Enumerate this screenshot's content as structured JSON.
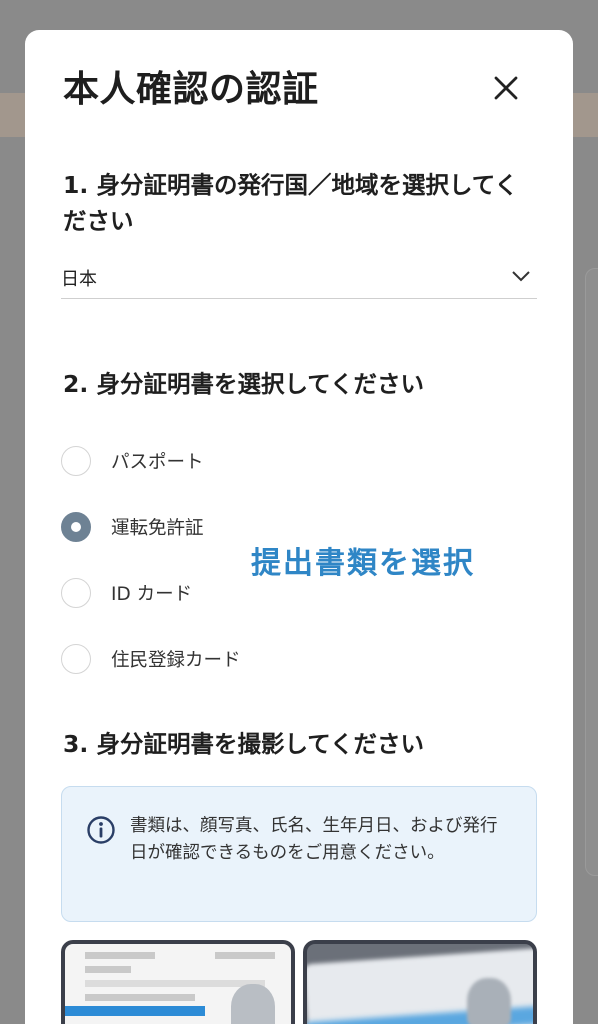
{
  "modal": {
    "title": "本人確認の認証",
    "close_icon": "close-icon"
  },
  "step1": {
    "title": "1. 身分証明書の発行国／地域を選択してください",
    "country_value": "日本",
    "dropdown_icon": "chevron-down-icon"
  },
  "step2": {
    "title": "2. 身分証明書を選択してください",
    "options": [
      {
        "label": "パスポート",
        "selected": false
      },
      {
        "label": "運転免許証",
        "selected": true
      },
      {
        "label": "ID カード",
        "selected": false
      },
      {
        "label": "住民登録カード",
        "selected": false
      }
    ],
    "annotation": "提出書類を選択"
  },
  "step3": {
    "title": "3. 身分証明書を撮影してください",
    "info_icon": "info-icon",
    "info_text": "書類は、顔写真、氏名、生年月日、および発行日が確認できるものをご用意ください。"
  },
  "colors": {
    "accent": "#2f86c6",
    "radio_selected": "#6e8294",
    "info_bg": "#eaf3fb",
    "info_border": "#c6dcef"
  }
}
